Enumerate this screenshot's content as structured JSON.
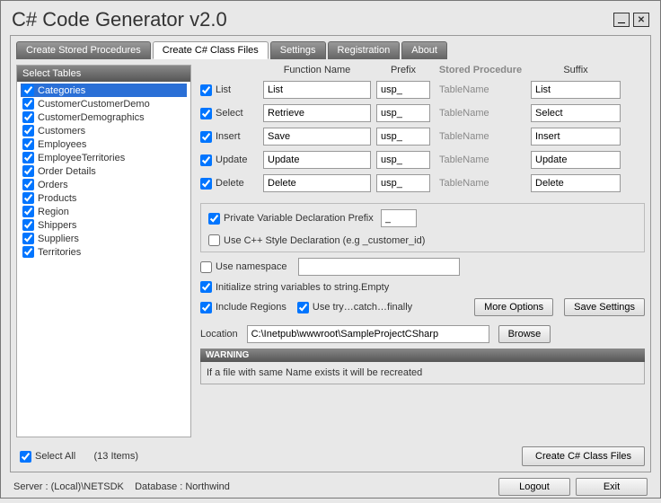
{
  "title": "C# Code Generator v2.0",
  "tabs": [
    {
      "label": "Create Stored Procedures",
      "active": false
    },
    {
      "label": "Create C# Class Files",
      "active": true
    },
    {
      "label": "Settings",
      "active": false
    },
    {
      "label": "Registration",
      "active": false
    },
    {
      "label": "About",
      "active": false
    }
  ],
  "panel_header": "Select Tables",
  "tables": [
    {
      "name": "Categories",
      "checked": true,
      "selected": true
    },
    {
      "name": "CustomerCustomerDemo",
      "checked": true
    },
    {
      "name": "CustomerDemographics",
      "checked": true
    },
    {
      "name": "Customers",
      "checked": true
    },
    {
      "name": "Employees",
      "checked": true
    },
    {
      "name": "EmployeeTerritories",
      "checked": true
    },
    {
      "name": "Order Details",
      "checked": true
    },
    {
      "name": "Orders",
      "checked": true
    },
    {
      "name": "Products",
      "checked": true
    },
    {
      "name": "Region",
      "checked": true
    },
    {
      "name": "Shippers",
      "checked": true
    },
    {
      "name": "Suppliers",
      "checked": true
    },
    {
      "name": "Territories",
      "checked": true
    }
  ],
  "select_all": "Select All",
  "items_count": "(13 Items)",
  "columns": {
    "fn": "Function Name",
    "pf": "Prefix",
    "sp": "Stored Procedure",
    "sf": "Suffix"
  },
  "functions": [
    {
      "label": "List",
      "fn": "List",
      "pf": "usp_",
      "tn": "TableName",
      "sf": "List"
    },
    {
      "label": "Select",
      "fn": "Retrieve",
      "pf": "usp_",
      "tn": "TableName",
      "sf": "Select"
    },
    {
      "label": "Insert",
      "fn": "Save",
      "pf": "usp_",
      "tn": "TableName",
      "sf": "Insert"
    },
    {
      "label": "Update",
      "fn": "Update",
      "pf": "usp_",
      "tn": "TableName",
      "sf": "Update"
    },
    {
      "label": "Delete",
      "fn": "Delete",
      "pf": "usp_",
      "tn": "TableName",
      "sf": "Delete"
    }
  ],
  "pvdp": {
    "label": "Private Variable Declaration Prefix",
    "value": "_",
    "cpp": "Use C++ Style Declaration (e.g _customer_id)"
  },
  "use_ns": "Use namespace",
  "init_string": "Initialize string variables to string.Empty",
  "inc_regions": "Include Regions",
  "use_try": "Use try…catch…finally",
  "more_opts": "More Options",
  "save_settings": "Save Settings",
  "location_lbl": "Location",
  "location_val": "C:\\Inetpub\\wwwroot\\SampleProjectCSharp",
  "browse": "Browse",
  "warning_hdr": "WARNING",
  "warning_body": "If a file with same Name exists it will be recreated",
  "create_btn": "Create C# Class Files",
  "server": "Server : (Local)\\NETSDK",
  "database": "Database : Northwind",
  "logout": "Logout",
  "exit": "Exit"
}
